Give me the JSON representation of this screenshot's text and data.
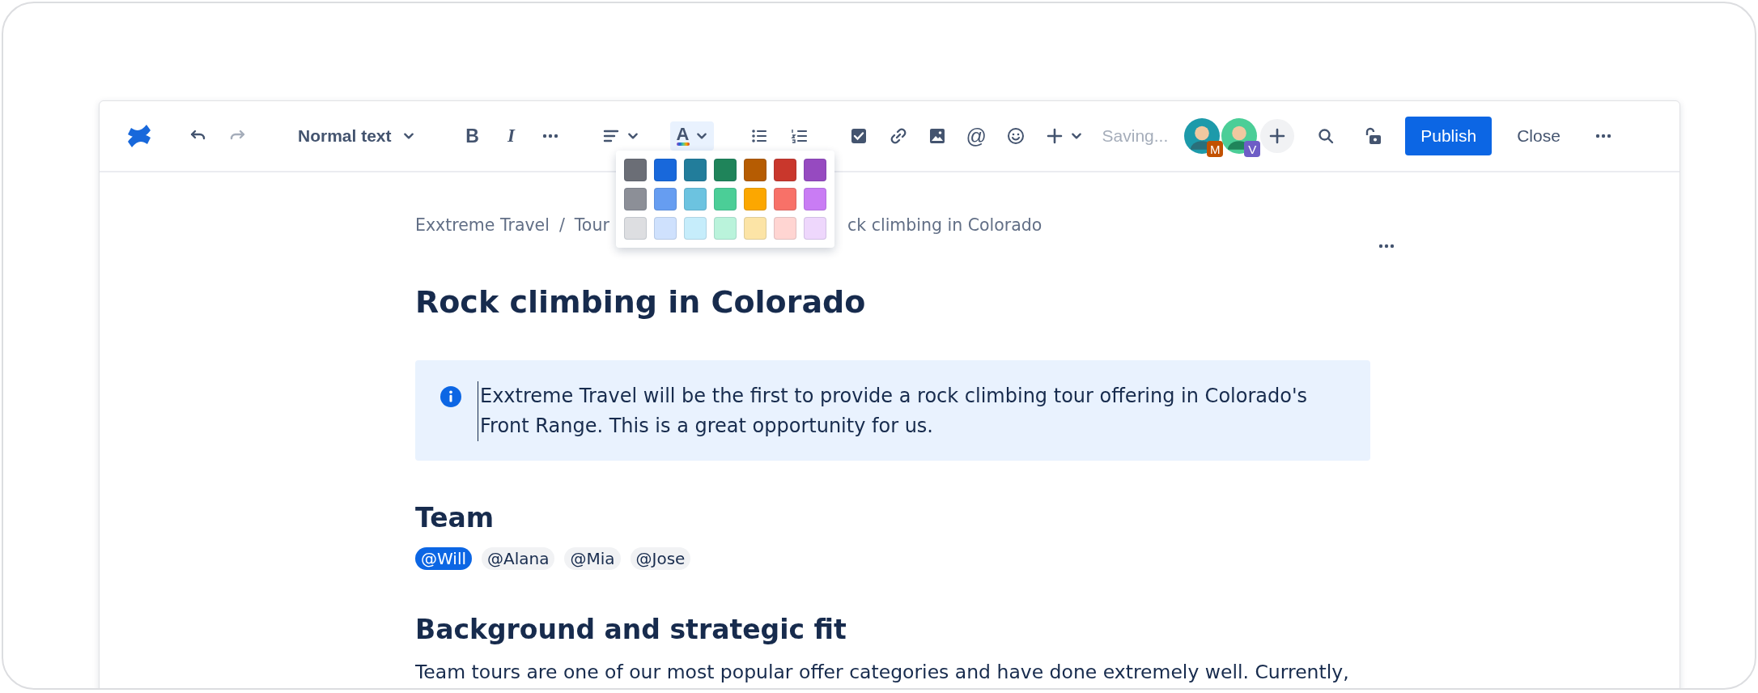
{
  "toolbar": {
    "undo": {
      "disabled": false
    },
    "redo": {
      "disabled": true
    },
    "text_style": "Normal text",
    "bold": "B",
    "italic": "I",
    "text_color": {
      "label": "A",
      "expanded": true
    },
    "mention": "@",
    "status": "Saving...",
    "collaborators": [
      {
        "initial": "M",
        "color": "#c25100"
      },
      {
        "initial": "V",
        "color": "#6e5dc6"
      }
    ],
    "publish": "Publish",
    "close": "Close"
  },
  "color_palette": {
    "rows": [
      {
        "swatches": [
          {
            "color": "#6b6e76"
          },
          {
            "color": "#1868db"
          },
          {
            "color": "#227d9b"
          },
          {
            "color": "#1f845a"
          },
          {
            "color": "#b65c02"
          },
          {
            "color": "#c9372c"
          },
          {
            "color": "#964ac0"
          }
        ]
      },
      {
        "swatches": [
          {
            "color": "#8c8f97"
          },
          {
            "color": "#669df1"
          },
          {
            "color": "#6cc3e0"
          },
          {
            "color": "#4bce97"
          },
          {
            "color": "#fca700"
          },
          {
            "color": "#f87168"
          },
          {
            "color": "#c97cf4"
          }
        ]
      },
      {
        "swatches": [
          {
            "color": "#dddee1"
          },
          {
            "color": "#cfe1fd"
          },
          {
            "color": "#c6edfb"
          },
          {
            "color": "#baf3db"
          },
          {
            "color": "#fce4a6"
          },
          {
            "color": "#ffd5d2"
          },
          {
            "color": "#eed7fc"
          }
        ]
      }
    ]
  },
  "page": {
    "breadcrumb": [
      "Exxtreme Travel",
      "/",
      "Tour",
      "ck climbing in Colorado"
    ],
    "title": "Rock climbing in Colorado",
    "info_panel": {
      "text": "Exxtreme Travel will be the first to provide a rock climbing tour offering in Colorado's Front Range. This is a great opportunity for us."
    },
    "sections": [
      {
        "heading": "Team",
        "mentions": [
          {
            "label": "@Will",
            "selected": true
          },
          {
            "label": "@Alana",
            "selected": false
          },
          {
            "label": "@Mia",
            "selected": false
          },
          {
            "label": "@Jose",
            "selected": false
          }
        ]
      },
      {
        "heading": "Background and strategic fit",
        "paragraph": "Team tours are one of our most popular offer categories and have done extremely well. Currently,"
      }
    ]
  }
}
